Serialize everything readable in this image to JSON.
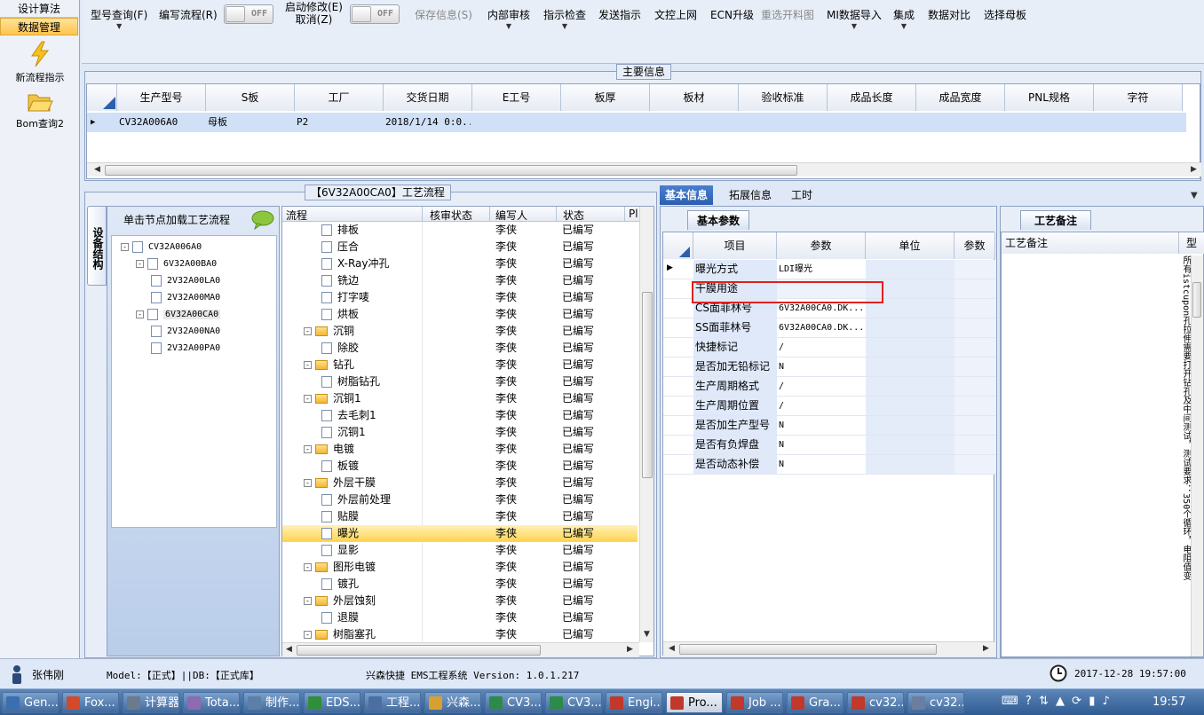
{
  "leftnav": {
    "tab_top": "设计算法",
    "tab_selected": "数据管理",
    "items": [
      {
        "label": "新流程指示",
        "icon": "lightning-icon"
      },
      {
        "label": "Bom查询2",
        "icon": "folder-open-icon"
      }
    ]
  },
  "toolbar": {
    "model_query": "型号查询(F)",
    "edit_flow": "编写流程(R)",
    "switch1": "OFF",
    "enable_modify": "启动修改(E)",
    "cancel": "取消(Z)",
    "switch2": "OFF",
    "save_info": "保存信息(S)",
    "internal_review": "内部审核",
    "instruction_check": "指示检查",
    "send_instruction": "发送指示",
    "upload_docs": "文控上网",
    "ecn_upgrade": "ECN升级",
    "reselect_material": "重选开料图",
    "mi_import": "MI数据导入",
    "integrate": "集成",
    "data_compare": "数据对比",
    "select_master": "选择母板"
  },
  "main_info": {
    "title": "主要信息",
    "columns": [
      "生产型号",
      "S板",
      "工厂",
      "交货日期",
      "E工号",
      "板厚",
      "板材",
      "验收标准",
      "成品长度",
      "成品宽度",
      "PNL规格",
      "字符"
    ],
    "row": [
      "CV32A006A0",
      "母板",
      "P2",
      "2018/1/14 0:0...",
      "",
      "",
      "",
      "",
      "",
      "",
      "",
      ""
    ]
  },
  "process": {
    "title": "【6V32A00CA0】工艺流程",
    "side_tab": "设备结构",
    "hint": "单击节点加载工艺流程",
    "tree": [
      {
        "label": "CV32A006A0",
        "level": 0,
        "expand": "-"
      },
      {
        "label": "6V32A00BA0",
        "level": 1,
        "expand": "-"
      },
      {
        "label": "2V32A00LA0",
        "level": 2,
        "expand": ""
      },
      {
        "label": "2V32A00MA0",
        "level": 2,
        "expand": ""
      },
      {
        "label": "6V32A00CA0",
        "level": 1,
        "expand": "-",
        "selected": true
      },
      {
        "label": "2V32A00NA0",
        "level": 2,
        "expand": ""
      },
      {
        "label": "2V32A00PA0",
        "level": 2,
        "expand": ""
      }
    ],
    "columns": [
      "流程",
      "核审状态",
      "编写人",
      "状态",
      "Pl"
    ],
    "rows": [
      {
        "name": "排板",
        "type": "page",
        "writer": "李侠",
        "status": "已编写"
      },
      {
        "name": "压合",
        "type": "page",
        "writer": "李侠",
        "status": "已编写"
      },
      {
        "name": "X-Ray冲孔",
        "type": "page",
        "writer": "李侠",
        "status": "已编写"
      },
      {
        "name": "铣边",
        "type": "page",
        "writer": "李侠",
        "status": "已编写"
      },
      {
        "name": "打字唛",
        "type": "page",
        "writer": "李侠",
        "status": "已编写"
      },
      {
        "name": "烘板",
        "type": "page",
        "writer": "李侠",
        "status": "已编写"
      },
      {
        "name": "沉铜",
        "type": "folder",
        "writer": "李侠",
        "status": "已编写"
      },
      {
        "name": "除胶",
        "type": "page",
        "writer": "李侠",
        "status": "已编写"
      },
      {
        "name": "钻孔",
        "type": "folder",
        "writer": "李侠",
        "status": "已编写"
      },
      {
        "name": "树脂钻孔",
        "type": "page",
        "writer": "李侠",
        "status": "已编写"
      },
      {
        "name": "沉铜1",
        "type": "folder",
        "writer": "李侠",
        "status": "已编写"
      },
      {
        "name": "去毛刺1",
        "type": "page",
        "writer": "李侠",
        "status": "已编写"
      },
      {
        "name": "沉铜1",
        "type": "page",
        "writer": "李侠",
        "status": "已编写"
      },
      {
        "name": "电镀",
        "type": "folder",
        "writer": "李侠",
        "status": "已编写"
      },
      {
        "name": "板镀",
        "type": "page",
        "writer": "李侠",
        "status": "已编写"
      },
      {
        "name": "外层干膜",
        "type": "folder",
        "writer": "李侠",
        "status": "已编写"
      },
      {
        "name": "外层前处理",
        "type": "page",
        "writer": "李侠",
        "status": "已编写"
      },
      {
        "name": "贴膜",
        "type": "page",
        "writer": "李侠",
        "status": "已编写"
      },
      {
        "name": "曝光",
        "type": "page",
        "writer": "李侠",
        "status": "已编写",
        "selected": true
      },
      {
        "name": "显影",
        "type": "page",
        "writer": "李侠",
        "status": "已编写"
      },
      {
        "name": "图形电镀",
        "type": "folder",
        "writer": "李侠",
        "status": "已编写"
      },
      {
        "name": "镀孔",
        "type": "page",
        "writer": "李侠",
        "status": "已编写"
      },
      {
        "name": "外层蚀刻",
        "type": "folder",
        "writer": "李侠",
        "status": "已编写"
      },
      {
        "name": "退膜",
        "type": "page",
        "writer": "李侠",
        "status": "已编写"
      },
      {
        "name": "树脂塞孔",
        "type": "folder",
        "writer": "李侠",
        "status": "已编写"
      }
    ]
  },
  "detail": {
    "tabs": [
      "基本信息",
      "拓展信息",
      "工时"
    ],
    "subtab": "基本参数",
    "columns": [
      "项目",
      "参数",
      "单位",
      "参数"
    ],
    "rows": [
      {
        "k": "曝光方式",
        "v": "LDI曝光"
      },
      {
        "k": "干膜用途",
        "v": ""
      },
      {
        "k": "CS面菲林号",
        "v": "6V32A00CA0.DK..."
      },
      {
        "k": "SS面菲林号",
        "v": "6V32A00CA0.DK..."
      },
      {
        "k": "快捷标记",
        "v": "/"
      },
      {
        "k": "是否加无铅标记",
        "v": "N"
      },
      {
        "k": "生产周期格式",
        "v": "/"
      },
      {
        "k": "生产周期位置",
        "v": "/"
      },
      {
        "k": "是否加生产型号",
        "v": "N"
      },
      {
        "k": "是否有负焊盘",
        "v": "N"
      },
      {
        "k": "是否动态补偿",
        "v": "N"
      }
    ]
  },
  "notes": {
    "title": "工艺备注",
    "col1": "工艺备注",
    "col2": "型",
    "vertical_text": "所有istcupon孔拉伸需要打开钻孔及中间测试，测试要求：350个循环，电阻值变"
  },
  "status": {
    "user": "张伟刚",
    "env": "Model:【正式】||DB:【正式库】",
    "app": "兴森快捷 EMS工程系统 Version: 1.0.1.217",
    "datetime": "2017-12-28 19:57:00"
  },
  "taskbar": {
    "items": [
      {
        "label": "Gen...",
        "color": "#3a6fb0"
      },
      {
        "label": "Fox...",
        "color": "#d04a2b"
      },
      {
        "label": "计算器",
        "color": "#6b7b8c"
      },
      {
        "label": "Tota...",
        "color": "#8c6bb0"
      },
      {
        "label": "制作...",
        "color": "#5b7fa8"
      },
      {
        "label": "EDS...",
        "color": "#2f8f3a"
      },
      {
        "label": "工程...",
        "color": "#4a6fa0"
      },
      {
        "label": "兴森...",
        "color": "#d8a030"
      },
      {
        "label": "CV3...",
        "color": "#2e8a4a"
      },
      {
        "label": "CV3...",
        "color": "#2e8a4a"
      },
      {
        "label": "Engi...",
        "color": "#c0392b"
      },
      {
        "label": "Pro...",
        "color": "#c0392b",
        "selected": true
      },
      {
        "label": "Job ...",
        "color": "#c0392b"
      },
      {
        "label": "Gra...",
        "color": "#c0392b"
      },
      {
        "label": "cv32...",
        "color": "#c0392b"
      },
      {
        "label": "cv32...",
        "color": "#6a7fa0"
      }
    ],
    "clock": "19:57"
  },
  "colors": {
    "accent": "#2c5fae",
    "selection": "#ffd34e",
    "highlight_box": "#e02020"
  }
}
